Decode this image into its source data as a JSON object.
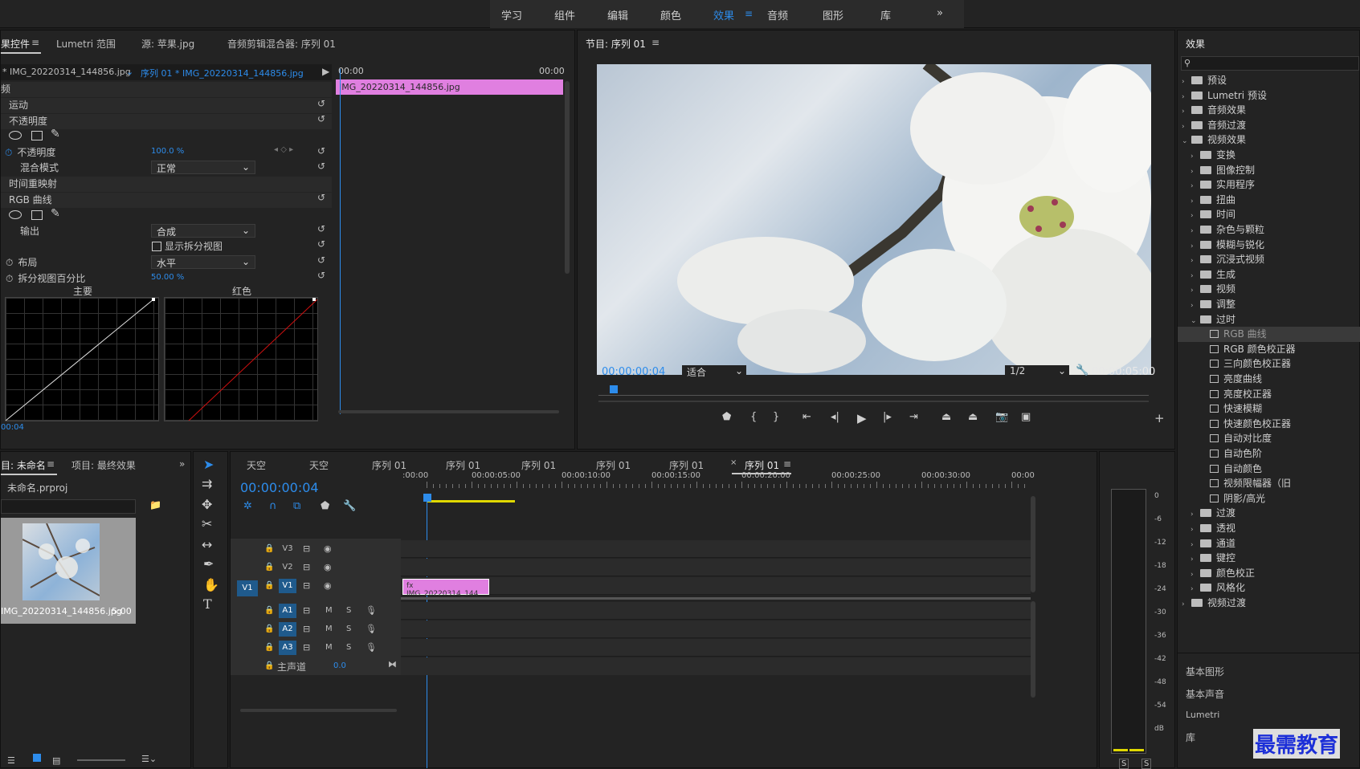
{
  "workspaces": [
    "学习",
    "组件",
    "编辑",
    "颜色",
    "效果",
    "音频",
    "图形",
    "库"
  ],
  "ws_active_index": 4,
  "ws_more": "»",
  "effect_controls": {
    "tabs": [
      "果控件",
      "Lumetri 范围",
      "源: 苹果.jpg",
      "音频剪辑混合器: 序列 01"
    ],
    "menu_icon": "≡",
    "source_clip": "* IMG_20220314_144856.jpg",
    "sequence_clip": "序列 01 * IMG_20220314_144856.jpg",
    "timecode_start": "00:00",
    "timecode_end": "00:00",
    "clip_bar_label": "IMG_20220314_144856.jpg",
    "section_label": "频",
    "motion": "运动",
    "opacity": "不透明度",
    "opacity_prop": "不透明度",
    "opacity_value": "100.0 %",
    "blend_label": "混合模式",
    "blend_value": "正常",
    "time_remap": "时间重映射",
    "rgb_curves": "RGB 曲线",
    "output_label": "输出",
    "output_value": "合成",
    "split_view": "显示拆分视图",
    "layout_label": "布局",
    "layout_value": "水平",
    "split_pct_label": "拆分视图百分比",
    "split_pct_value": "50.00 %",
    "graph1_label": "主要",
    "graph2_label": "红色",
    "current_time": "00:04"
  },
  "program": {
    "title": "节目: 序列 01",
    "menu_icon": "≡",
    "timecode": "00:00:00:04",
    "fit": "适合",
    "resolution": "1/2",
    "duration": "00:00:05:00"
  },
  "effects_panel": {
    "title": "效果",
    "top_folders": [
      "预设",
      "Lumetri 预设",
      "音频效果",
      "音频过渡",
      "视频效果"
    ],
    "sub_folders": [
      "变换",
      "图像控制",
      "实用程序",
      "扭曲",
      "时间",
      "杂色与颗粒",
      "模糊与锐化",
      "沉浸式视频",
      "生成",
      "视频",
      "调整",
      "过时"
    ],
    "obsolete_items": [
      "RGB 曲线",
      "RGB 颜色校正器",
      "三向颜色校正器",
      "亮度曲线",
      "亮度校正器",
      "快速模糊",
      "快速颜色校正器",
      "自动对比度",
      "自动色阶",
      "自动颜色",
      "视频限幅器（旧",
      "阴影/高光"
    ],
    "after_folders": [
      "过渡",
      "透视",
      "通道",
      "键控",
      "颜色校正",
      "风格化"
    ],
    "last_folder": "视频过渡",
    "bottom_panels": [
      "基本图形",
      "基本声音",
      "Lumetri",
      "库"
    ]
  },
  "project": {
    "tabs": [
      "目: 未命名",
      "项目: 最终效果"
    ],
    "menu_icon": "≡",
    "more": "»",
    "file": "未命名.prproj",
    "clip_name": "IMG_20220314_144856.jpg",
    "clip_duration": "5:00"
  },
  "timeline": {
    "tabs": [
      "天空",
      "天空",
      "序列 01",
      "序列 01",
      "序列 01",
      "序列 01",
      "序列 01",
      "序列 01"
    ],
    "close_icon": "×",
    "menu_icon": "≡",
    "timecode": "00:00:00:04",
    "ruler": [
      ":00:00",
      "00:00:05:00",
      "00:00:10:00",
      "00:00:15:00",
      "00:00:20:00",
      "00:00:25:00",
      "00:00:30:00",
      "00:00"
    ],
    "video_tracks": [
      "V3",
      "V2",
      "V1"
    ],
    "audio_tracks": [
      "A1",
      "A2",
      "A3"
    ],
    "src_v1": "V1",
    "master": "主声道",
    "master_value": "0.0",
    "clip_label": "IMG_20220314_144",
    "m": "M",
    "s": "S"
  },
  "meter": {
    "scale": [
      "0",
      "-6",
      "-12",
      "-18",
      "-24",
      "-30",
      "-36",
      "-42",
      "-48",
      "-54",
      "dB"
    ],
    "solo": [
      "S",
      "S"
    ]
  },
  "watermark": "最需教育",
  "colors": {
    "accent": "#2d8ceb",
    "clip": "#e07fe0",
    "bg": "#232323"
  }
}
